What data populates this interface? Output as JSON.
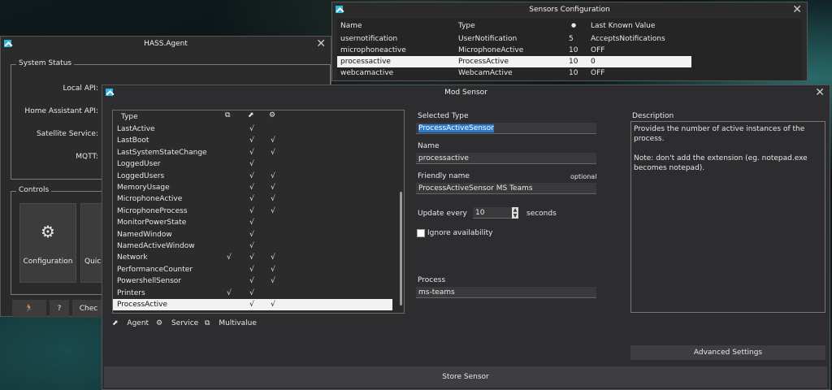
{
  "sensors_window": {
    "title": "Sensors Configuration",
    "columns": [
      "Name",
      "Type",
      "",
      "Last Known Value"
    ],
    "rows": [
      {
        "name": "usernotification",
        "type": "UserNotification",
        "num": "5",
        "value": "AcceptsNotifications"
      },
      {
        "name": "microphoneactive",
        "type": "MicrophoneActive",
        "num": "10",
        "value": "OFF"
      },
      {
        "name": "processactive",
        "type": "ProcessActive",
        "num": "10",
        "value": "0"
      },
      {
        "name": "webcamactive",
        "type": "WebcamActive",
        "num": "10",
        "value": "OFF"
      }
    ]
  },
  "hass_window": {
    "title": "HASS.Agent",
    "system_status_legend": "System Status",
    "status_labels": [
      "Local API:",
      "Home Assistant API:",
      "Satellite Service:",
      "MQTT:"
    ],
    "controls_legend": "Controls",
    "configuration_label": "Configuration",
    "quick_label": "Quick",
    "help_label": "?",
    "check_label": "Chec"
  },
  "mod_window": {
    "title": "Mod Sensor",
    "list_header": "Type",
    "items": [
      {
        "name": "LastActive",
        "multi": "",
        "agent": "√",
        "service": ""
      },
      {
        "name": "LastBoot",
        "multi": "",
        "agent": "√",
        "service": "√"
      },
      {
        "name": "LastSystemStateChange",
        "multi": "",
        "agent": "√",
        "service": "√"
      },
      {
        "name": "LoggedUser",
        "multi": "",
        "agent": "√",
        "service": ""
      },
      {
        "name": "LoggedUsers",
        "multi": "",
        "agent": "√",
        "service": "√"
      },
      {
        "name": "MemoryUsage",
        "multi": "",
        "agent": "√",
        "service": "√"
      },
      {
        "name": "MicrophoneActive",
        "multi": "",
        "agent": "√",
        "service": "√"
      },
      {
        "name": "MicrophoneProcess",
        "multi": "",
        "agent": "√",
        "service": "√"
      },
      {
        "name": "MonitorPowerState",
        "multi": "",
        "agent": "√",
        "service": ""
      },
      {
        "name": "NamedWindow",
        "multi": "",
        "agent": "√",
        "service": ""
      },
      {
        "name": "NamedActiveWindow",
        "multi": "",
        "agent": "√",
        "service": ""
      },
      {
        "name": "Network",
        "multi": "√",
        "agent": "√",
        "service": "√"
      },
      {
        "name": "PerformanceCounter",
        "multi": "",
        "agent": "√",
        "service": "√"
      },
      {
        "name": "PowershellSensor",
        "multi": "",
        "agent": "√",
        "service": "√"
      },
      {
        "name": "Printers",
        "multi": "√",
        "agent": "√",
        "service": ""
      },
      {
        "name": "ProcessActive",
        "multi": "",
        "agent": "√",
        "service": "√"
      }
    ],
    "legend_agent": "Agent",
    "legend_service": "Service",
    "legend_multivalue": "Multivalue",
    "selected_type_label": "Selected Type",
    "selected_type_value": "ProcessActiveSensor",
    "name_label": "Name",
    "name_value": "processactive",
    "friendly_label": "Friendly name",
    "friendly_optional": "optional",
    "friendly_value": "ProcessActiveSensor MS Teams",
    "update_label": "Update every",
    "update_value": "10",
    "update_unit": "seconds",
    "ignore_label": "Ignore availability",
    "process_label": "Process",
    "process_value": "ms-teams",
    "description_label": "Description",
    "description_line1": "Provides the number of active instances of the process.",
    "description_line2": "Note: don't add the extension (eg. notepad.exe becomes notepad).",
    "advanced_label": "Advanced Settings",
    "store_label": "Store Sensor"
  }
}
